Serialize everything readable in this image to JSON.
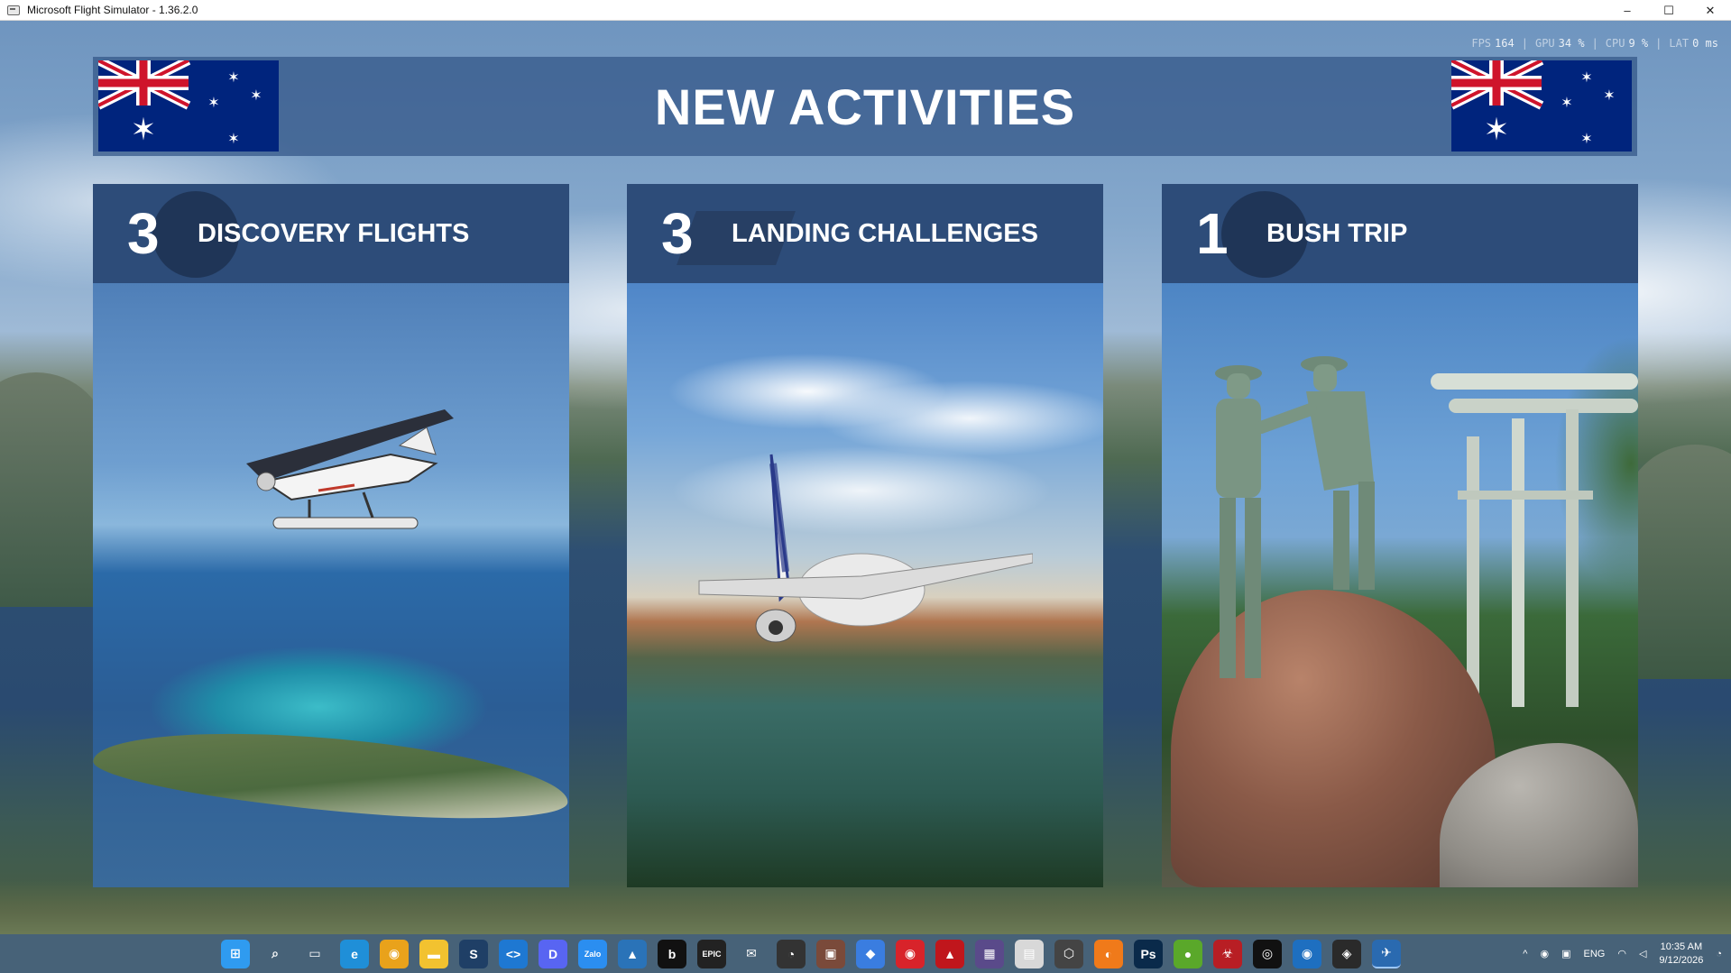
{
  "window": {
    "title": "Microsoft Flight Simulator - 1.36.2.0",
    "controls": {
      "minimize": "–",
      "maximize": "☐",
      "close": "✕"
    }
  },
  "perf": {
    "fps_label": "FPS",
    "fps_value": "164",
    "gpu_label": "GPU",
    "gpu_value": "34 %",
    "cpu_label": "CPU",
    "cpu_value": "9 %",
    "lat_label": "LAT",
    "lat_value": "0 ms"
  },
  "banner": {
    "title": "NEW ACTIVITIES"
  },
  "cards": [
    {
      "count": "3",
      "label": "DISCOVERY FLIGHTS"
    },
    {
      "count": "3",
      "label": "LANDING CHALLENGES"
    },
    {
      "count": "1",
      "label": "BUSH TRIP"
    }
  ],
  "taskbar": {
    "apps": [
      {
        "name": "start-icon",
        "glyph": "⊞",
        "color": "#2f9bf0"
      },
      {
        "name": "search-icon",
        "glyph": "⌕",
        "color": "rgba(0,0,0,0)"
      },
      {
        "name": "task-view-icon",
        "glyph": "▭",
        "color": "rgba(0,0,0,0)"
      },
      {
        "name": "edge-icon",
        "glyph": "e",
        "color": "#1f8fd8"
      },
      {
        "name": "chrome-icon",
        "glyph": "◉",
        "color": "#e9a21b"
      },
      {
        "name": "file-explorer-icon",
        "glyph": "▬",
        "color": "#f2c230"
      },
      {
        "name": "steam-icon",
        "glyph": "S",
        "color": "#1f3f66"
      },
      {
        "name": "vscode-icon",
        "glyph": "<>",
        "color": "#1e78d2"
      },
      {
        "name": "discord-icon",
        "glyph": "D",
        "color": "#5865f2"
      },
      {
        "name": "zalo-icon",
        "glyph": "Zalo",
        "color": "#2b8ef0"
      },
      {
        "name": "photos-icon",
        "glyph": "▲",
        "color": "#2a73b8"
      },
      {
        "name": "app-b-icon",
        "glyph": "b",
        "color": "#111111"
      },
      {
        "name": "epic-games-icon",
        "glyph": "EPIC",
        "color": "#222222"
      },
      {
        "name": "mail-icon",
        "glyph": "✉",
        "color": "rgba(0,0,0,0)"
      },
      {
        "name": "obs-icon",
        "glyph": "◔",
        "color": "#333333"
      },
      {
        "name": "game-app-icon",
        "glyph": "▣",
        "color": "#7a4a3a"
      },
      {
        "name": "store-icon",
        "glyph": "◆",
        "color": "#3a7de0"
      },
      {
        "name": "red-app-icon",
        "glyph": "◉",
        "color": "#d8232a"
      },
      {
        "name": "red-launcher-icon",
        "glyph": "▲",
        "color": "#c0161c"
      },
      {
        "name": "media-icon",
        "glyph": "▦",
        "color": "#5a4a8a"
      },
      {
        "name": "document-icon",
        "glyph": "▤",
        "color": "#d8d8d8"
      },
      {
        "name": "cube-icon",
        "glyph": "⬡",
        "color": "#444444"
      },
      {
        "name": "orange-app-icon",
        "glyph": "◐",
        "color": "#f07a1a"
      },
      {
        "name": "photoshop-icon",
        "glyph": "Ps",
        "color": "#0a2a4a"
      },
      {
        "name": "green-app-icon",
        "glyph": "●",
        "color": "#5aa82a"
      },
      {
        "name": "biohazard-icon",
        "glyph": "☣",
        "color": "#b81e24"
      },
      {
        "name": "white-circle-icon",
        "glyph": "◎",
        "color": "#111111"
      },
      {
        "name": "blue-app-icon",
        "glyph": "◉",
        "color": "#1e6fc0"
      },
      {
        "name": "yellow-app-icon",
        "glyph": "◈",
        "color": "#2a2a2a"
      },
      {
        "name": "flight-sim-icon",
        "glyph": "✈",
        "color": "#2a6ab0"
      }
    ],
    "tray": {
      "chevron": "^",
      "lang": "ENG",
      "time": "10:35 AM",
      "date": "9/12/2026"
    }
  }
}
